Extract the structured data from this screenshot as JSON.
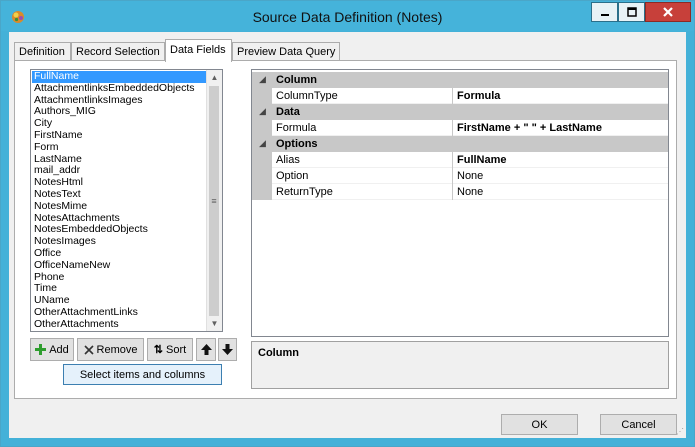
{
  "window": {
    "title": "Source Data Definition (Notes)",
    "colors": {
      "titlebar": "#45b3da",
      "close": "#c7403a",
      "selection": "#3399ff",
      "category": "#c8c8c8"
    }
  },
  "tabs": [
    {
      "label": "Definition",
      "active": false
    },
    {
      "label": "Record Selection",
      "active": false
    },
    {
      "label": "Data Fields",
      "active": true
    },
    {
      "label": "Preview Data Query",
      "active": false
    }
  ],
  "fields_list": {
    "selected": "FullName",
    "items": [
      "FullName",
      "AttachmentlinksEmbeddedObjects",
      "AttachmentlinksImages",
      "Authors_MIG",
      "City",
      "FirstName",
      "Form",
      "LastName",
      "mail_addr",
      "NotesHtml",
      "NotesText",
      "NotesMime",
      "NotesAttachments",
      "NotesEmbeddedObjects",
      "NotesImages",
      "Office",
      "OfficeNameNew",
      "Phone",
      "Time",
      "UName",
      "OtherAttachmentLinks",
      "OtherAttachments"
    ]
  },
  "list_buttons": {
    "add": "Add",
    "remove": "Remove",
    "sort": "Sort",
    "select_items": "Select items and columns"
  },
  "property_grid": {
    "categories": [
      {
        "name": "Column",
        "properties": [
          {
            "name": "ColumnType",
            "value": "Formula",
            "bold": true
          }
        ]
      },
      {
        "name": "Data",
        "properties": [
          {
            "name": "Formula",
            "value": "FirstName + \" \" + LastName",
            "bold": true
          }
        ]
      },
      {
        "name": "Options",
        "properties": [
          {
            "name": "Alias",
            "value": "FullName",
            "bold": true
          },
          {
            "name": "Option",
            "value": "None",
            "bold": false
          },
          {
            "name": "ReturnType",
            "value": "None",
            "bold": false
          }
        ]
      }
    ]
  },
  "help": {
    "title": "Column"
  },
  "footer": {
    "ok": "OK",
    "cancel": "Cancel"
  }
}
